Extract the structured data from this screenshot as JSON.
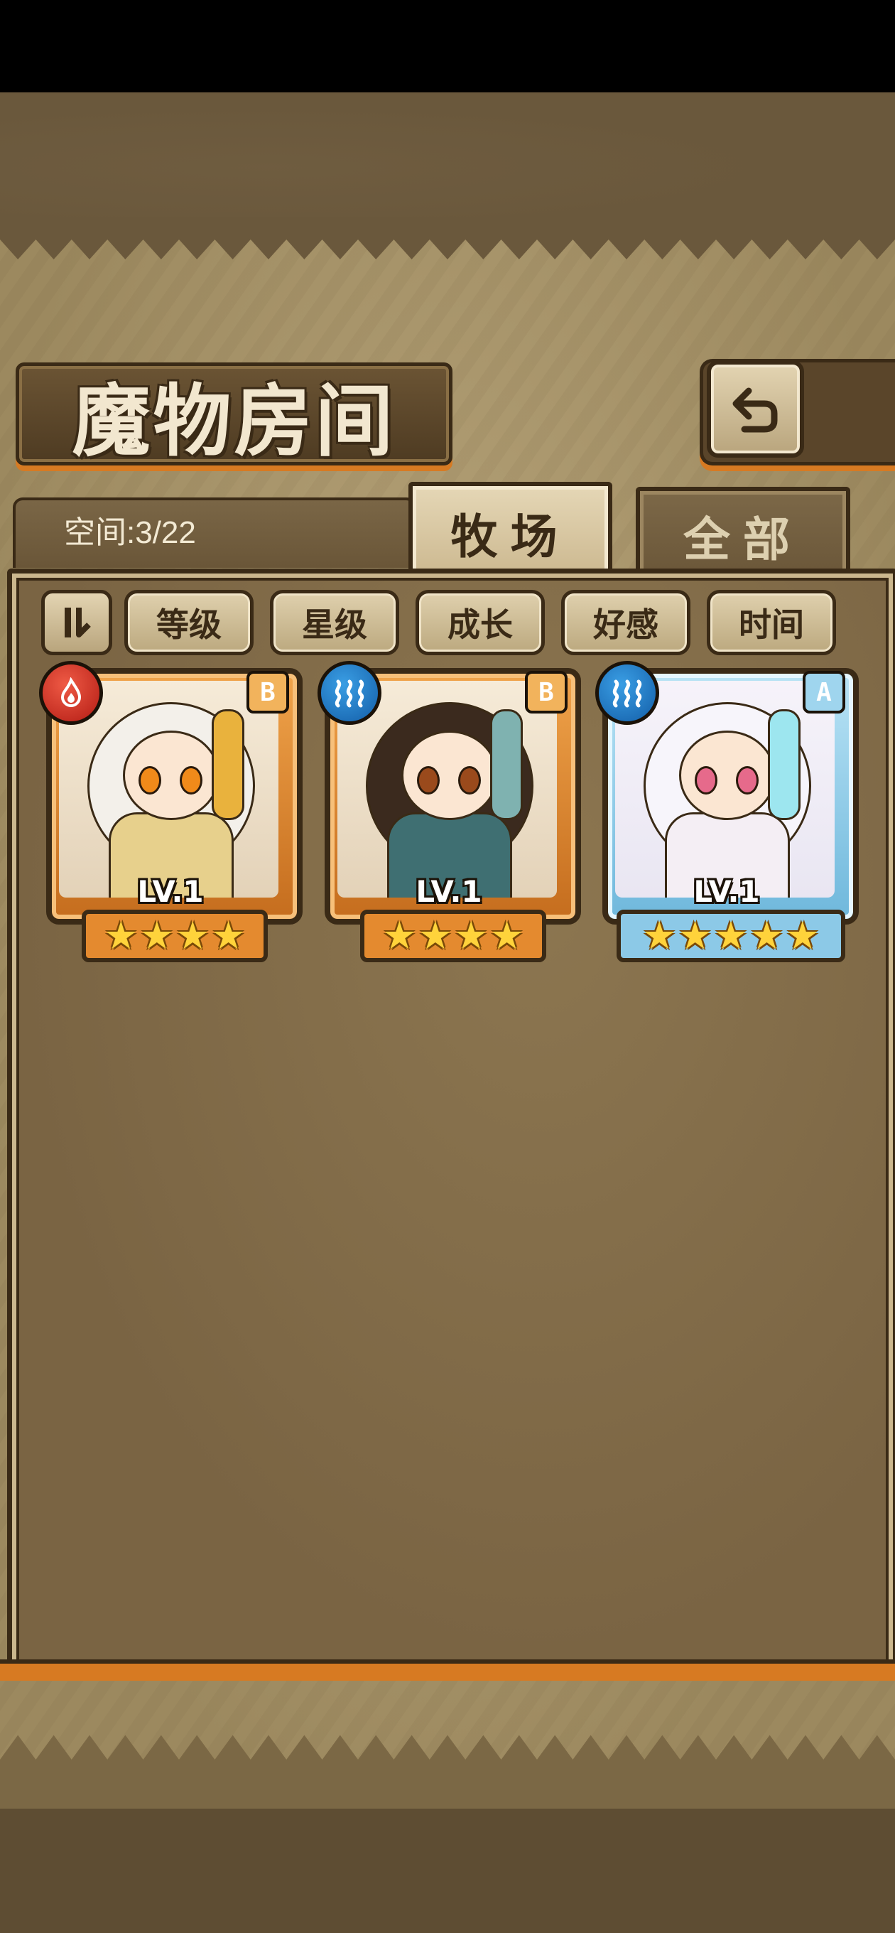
{
  "header": {
    "title": "魔物房间",
    "back_icon": "return-icon"
  },
  "tabs": {
    "space_label": "空间:3/22",
    "items": [
      {
        "label": "牧场",
        "active": true
      },
      {
        "label": "全部",
        "active": false
      }
    ]
  },
  "sort": {
    "toggle_label": "⥯",
    "buttons": [
      "等级",
      "星级",
      "成长",
      "好感",
      "时间"
    ]
  },
  "monsters": [
    {
      "element": "fire",
      "element_icon": "fire-element-icon",
      "rank": "B",
      "level": "LV.1",
      "stars": 4,
      "frame": "bronze",
      "palette": {
        "hair": "#f3f0ea",
        "accent": "#e9b23d",
        "eye": "#f08a1a",
        "body": "#e7d08c"
      }
    },
    {
      "element": "water",
      "element_icon": "water-element-icon",
      "rank": "B",
      "level": "LV.1",
      "stars": 4,
      "frame": "bronze",
      "palette": {
        "hair": "#3b2a1e",
        "accent": "#7fb2b0",
        "eye": "#9a4a1c",
        "body": "#3f6f72"
      }
    },
    {
      "element": "water",
      "element_icon": "water-element-icon",
      "rank": "A",
      "level": "LV.1",
      "stars": 5,
      "frame": "ice",
      "palette": {
        "hair": "#f7f5fb",
        "accent": "#9de6ef",
        "eye": "#e66a8b",
        "body": "#f4eef4"
      }
    }
  ]
}
